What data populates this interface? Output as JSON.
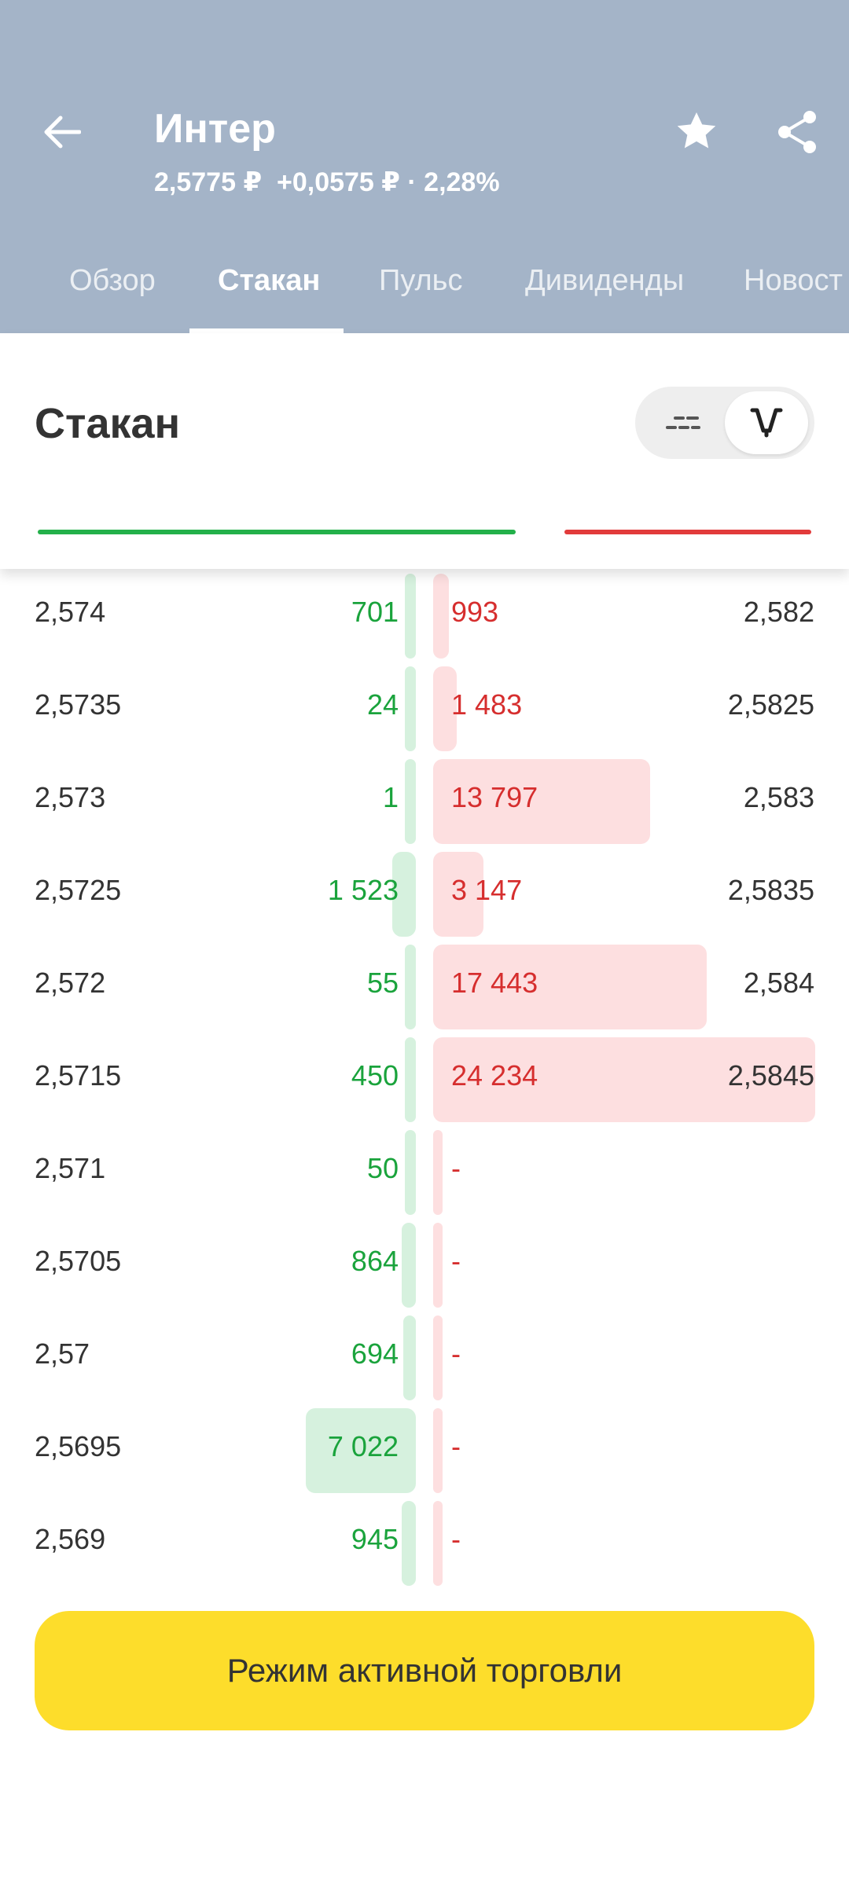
{
  "header": {
    "title": "Интер",
    "subtitle": "2,5775 ₽  +0,0575 ₽ · 2,28%"
  },
  "tabs": [
    {
      "label": "Обзор"
    },
    {
      "label": "Стакан"
    },
    {
      "label": "Пульс"
    },
    {
      "label": "Дивиденды"
    },
    {
      "label": "Новост"
    }
  ],
  "section": {
    "title": "Стакан"
  },
  "order_book": {
    "rows": [
      {
        "bid_price": "2,574",
        "bid_qty": "701",
        "ask_qty": "993",
        "ask_price": "2,582"
      },
      {
        "bid_price": "2,5735",
        "bid_qty": "24",
        "ask_qty": "1 483",
        "ask_price": "2,5825"
      },
      {
        "bid_price": "2,573",
        "bid_qty": "1",
        "ask_qty": "13 797",
        "ask_price": "2,583"
      },
      {
        "bid_price": "2,5725",
        "bid_qty": "1 523",
        "ask_qty": "3 147",
        "ask_price": "2,5835"
      },
      {
        "bid_price": "2,572",
        "bid_qty": "55",
        "ask_qty": "17 443",
        "ask_price": "2,584"
      },
      {
        "bid_price": "2,5715",
        "bid_qty": "450",
        "ask_qty": "24 234",
        "ask_price": "2,5845"
      },
      {
        "bid_price": "2,571",
        "bid_qty": "50",
        "ask_qty": "-",
        "ask_price": ""
      },
      {
        "bid_price": "2,5705",
        "bid_qty": "864",
        "ask_qty": "-",
        "ask_price": ""
      },
      {
        "bid_price": "2,57",
        "bid_qty": "694",
        "ask_qty": "-",
        "ask_price": ""
      },
      {
        "bid_price": "2,5695",
        "bid_qty": "7 022",
        "ask_qty": "-",
        "ask_price": ""
      },
      {
        "bid_price": "2,569",
        "bid_qty": "945",
        "ask_qty": "-",
        "ask_price": ""
      }
    ]
  },
  "actions": {
    "active_trading_label": "Режим активной торговли"
  },
  "colors": {
    "header_bg": "#a4b4c8",
    "bid_green": "#1aa33c",
    "ask_red": "#d62e2e",
    "action_yellow": "#fddd2b"
  }
}
